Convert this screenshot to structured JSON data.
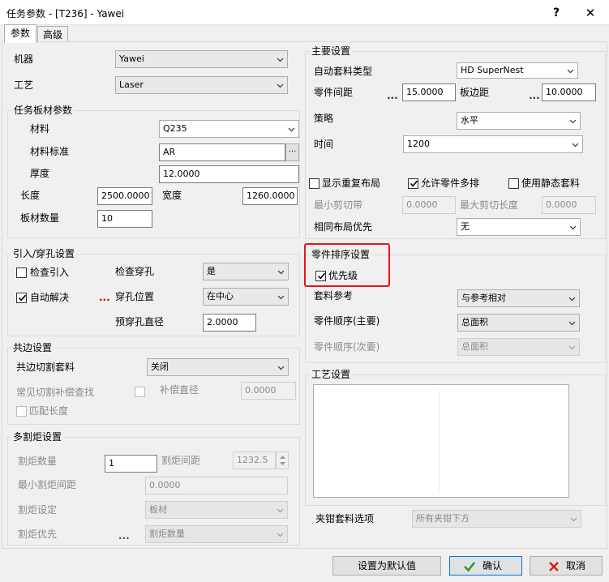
{
  "window": {
    "title": "任务参数 - [T236] - Yawei",
    "help": "?",
    "close": "✕"
  },
  "tabs": [
    {
      "label": "参数"
    },
    {
      "label": "高级"
    }
  ],
  "left": {
    "machine": {
      "label": "机器",
      "value": "Yawei"
    },
    "process": {
      "label": "工艺",
      "value": "Laser"
    },
    "sheet": {
      "title": "任务板材参数",
      "material_label": "材料",
      "material_value": "Q235",
      "standard_label": "材料标准",
      "standard_value": "AR",
      "standard_btn": "...",
      "thickness_label": "厚度",
      "thickness_value": "12.0000",
      "length_label": "长度",
      "length_value": "2500.0000",
      "width_label": "宽度",
      "width_value": "1260.0000",
      "count_label": "板材数量",
      "count_value": "10"
    },
    "leadin": {
      "title": "引入/穿孔设置",
      "check_leadin_label": "检查引入",
      "check_pierce_label": "检查穿孔",
      "check_pierce_value": "是",
      "auto_resolve_label": "自动解决",
      "auto_resolve_dots": "...",
      "pierce_pos_label": "穿孔位置",
      "pierce_pos_value": "在中心",
      "prepierce_label": "预穿孔直径",
      "prepierce_value": "2.0000"
    },
    "common": {
      "title": "共边设置",
      "cut_label": "共边切割套料",
      "cut_value": "关闭",
      "comp_label": "常见切割补偿查找",
      "comp_dia_label": "补偿直径",
      "comp_dia_value": "0.0000",
      "match_label": "匹配长度"
    },
    "multitorch": {
      "title": "多割炬设置",
      "count_label": "割炬数量",
      "count_value": "1",
      "spacing_label": "割炬间距",
      "spacing_value": "1232.5",
      "min_spacing_label": "最小割炬间距",
      "min_spacing_value": "0.0000",
      "setting_label": "割炬设定",
      "setting_value": "板材",
      "priority_label": "割炬优先",
      "priority_dots": "...",
      "priority_value": "割炬数量"
    }
  },
  "right": {
    "main": {
      "title": "主要设置",
      "nest_type_label": "自动套料类型",
      "nest_type_value": "HD SuperNest",
      "part_gap_label": "零件间距",
      "part_gap_dots": "...",
      "part_gap_value": "15.0000",
      "edge_gap_label": "板边距",
      "edge_gap_dots": "...",
      "edge_gap_value": "10.0000",
      "strategy_label": "策略",
      "strategy_value": "水平",
      "time_label": "时间",
      "time_value": "1200",
      "show_repeat_label": "显示重复布局",
      "allow_multi_label": "允许零件多排",
      "static_nest_label": "使用静态套料",
      "min_cut_label": "最小剪切带",
      "min_cut_value": "0.0000",
      "max_cut_label": "最大剪切长度",
      "max_cut_value": "0.0000",
      "same_layout_label": "相同布局优先",
      "same_layout_value": "无"
    },
    "ordering": {
      "title": "零件排序设置",
      "priority_label": "优先级",
      "ref_label": "套料参考",
      "ref_value": "与参考相对",
      "primary_label": "零件顺序(主要)",
      "primary_value": "总面积",
      "secondary_label": "零件顺序(次要)",
      "secondary_value": "总面积"
    },
    "process": {
      "title": "工艺设置"
    },
    "clamp": {
      "label": "夹钳套料选项",
      "value": "所有夹钳下方"
    }
  },
  "footer": {
    "default_label": "设置为默认值",
    "ok_label": "确认",
    "cancel_label": "取消"
  },
  "colors": {
    "highlight": "#e8141c",
    "ok": "#1f9d2f",
    "cancel": "#d9201a",
    "focus": "#0078d7"
  },
  "icons": {
    "ok": "check-icon",
    "cancel": "x-icon",
    "dropdown": "chevron-down-icon"
  }
}
